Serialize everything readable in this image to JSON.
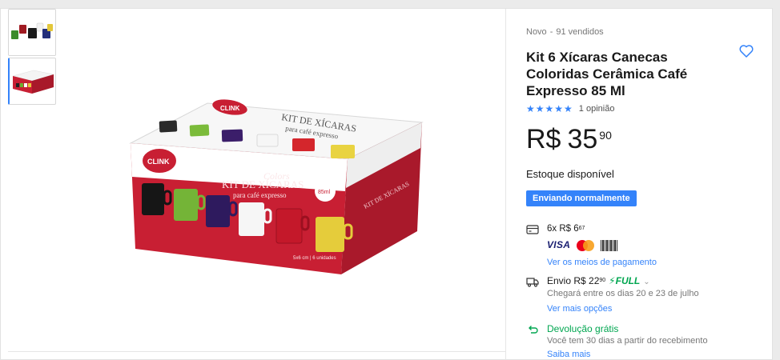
{
  "product": {
    "condition": "Novo",
    "sold": "91 vendidos",
    "title": "Kit 6 Xícaras Canecas Coloridas Cerâmica Café Expresso 85 Ml",
    "rating_stars": "★★★★★",
    "rating": 5,
    "reviews": "1 opinião",
    "price": {
      "currency": "R$",
      "integer": "35",
      "cents": "90"
    },
    "stock": "Estoque disponível",
    "shipping_badge": "Enviando normalmente"
  },
  "installments": {
    "text": "6x R$ 6",
    "cents": "67",
    "cards": [
      "VISA",
      "Mastercard",
      "Boleto"
    ],
    "visa_label": "VISA",
    "boleto_label": "Boleto",
    "link": "Ver os meios de pagamento"
  },
  "shipping": {
    "label": "Envio R$ 22",
    "cents": "90",
    "full_label": "FULL",
    "arrival": "Chegará entre os dias 20 e 23 de julho",
    "link": "Ver mais opções"
  },
  "returns": {
    "label": "Devolução grátis",
    "detail": "Você tem 30 dias a partir do recebimento",
    "link": "Saiba mais"
  },
  "box": {
    "brand": "CLINK",
    "title_top": "KIT DE XÍCARAS",
    "subtitle_top": "para café expresso",
    "title_front": "KIT DE XÍCARAS",
    "subtitle_front": "para café expresso",
    "colors_label": "Colors",
    "volume": "85ml",
    "footer": "5x6 cm | 6 unidades"
  },
  "colors": {
    "accent": "#3483fa",
    "green": "#00a650",
    "box_red": "#c81f33"
  }
}
